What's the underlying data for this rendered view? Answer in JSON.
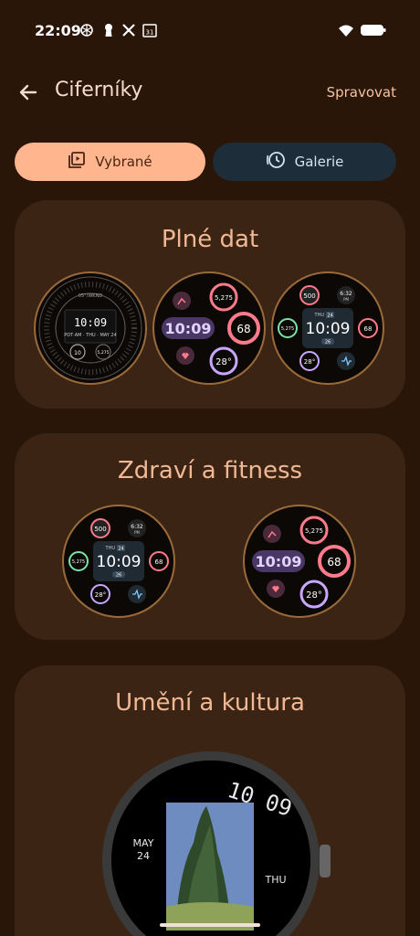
{
  "status": {
    "time": "22:09",
    "icons": [
      "openai-icon",
      "keyhole-icon",
      "x-icon",
      "calendar-icon"
    ],
    "calendar_day": "31"
  },
  "header": {
    "title": "Ciferníky",
    "manage": "Spravovat"
  },
  "tabs": [
    {
      "label": "Vybrané",
      "icon": "featured-icon",
      "selected": true
    },
    {
      "label": "Galerie",
      "icon": "clock-icon",
      "selected": false
    }
  ],
  "sections": [
    {
      "title": "Plné dat"
    },
    {
      "title": "Zdraví a fitness"
    },
    {
      "title": "Umění a kultura"
    }
  ],
  "watch_faces": {
    "analog": {
      "time": "10:09",
      "date": "PDT·AM · THU · MAY 24",
      "top": "05°/WKND",
      "sub_a": "10",
      "sub_b": "5,275"
    },
    "pills": {
      "time": "10:09",
      "steps": "5,275",
      "heart": "68",
      "temp": "28°"
    },
    "grid": {
      "time": "10:09",
      "day": "THU",
      "date": "24",
      "cal": "500",
      "clock": "6:32",
      "clock_sub": "PM",
      "steps": "5,275",
      "heart": "68",
      "temp": "28°",
      "badge": "26"
    },
    "art": {
      "time": "10 09",
      "month": "MAY",
      "day_num": "24",
      "weekday": "THU"
    }
  },
  "colors": {
    "background": "#2a1509",
    "card": "#3b2413",
    "accent": "#ffb68f",
    "title": "#f0b895",
    "purple": "#c8a8ff",
    "pink": "#ff7b8b",
    "green": "#7be3a8"
  }
}
